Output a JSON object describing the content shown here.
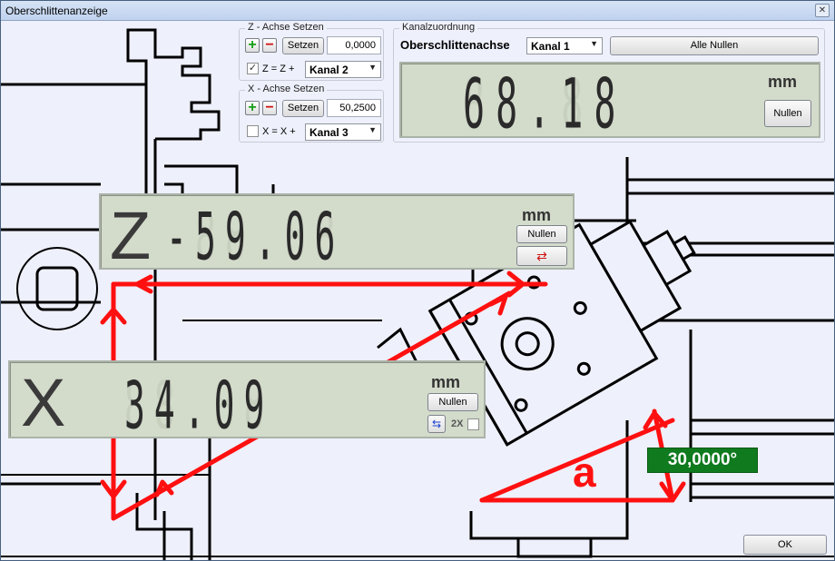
{
  "window": {
    "title": "Oberschlittenanzeige",
    "close_glyph": "✕"
  },
  "z_group": {
    "title": "Z - Achse Setzen",
    "setzen_label": "Setzen",
    "value": "0,0000",
    "checkbox_checked": true,
    "formula": "Z = Z  +",
    "channel": "Kanal 2"
  },
  "x_group": {
    "title": "X - Achse Setzen",
    "setzen_label": "Setzen",
    "value": "50,2500",
    "checkbox_checked": false,
    "formula": "X = X  +",
    "channel": "Kanal 3"
  },
  "kanal": {
    "title": "Kanalzuordnung",
    "axis_label": "Oberschlittenachse",
    "channel": "Kanal 1",
    "zero_all_label": "Alle Nullen"
  },
  "top_display": {
    "value": "68.18",
    "unit": "mm",
    "zero_label": "Nullen"
  },
  "z_display": {
    "axis": "Z",
    "sign": "-",
    "value": "59.06",
    "unit": "mm",
    "zero_label": "Nullen",
    "swap_icon": "direction-swap-icon"
  },
  "x_display": {
    "axis": "X",
    "value": "34.09",
    "unit": "mm",
    "zero_label": "Nullen",
    "diameter_label": "2X",
    "diameter_checked": false
  },
  "angle": {
    "value": "30,0000°",
    "a_label": "a"
  },
  "ok_label": "OK",
  "colors": {
    "lcd_bg": "#d3dbcb",
    "accent_red": "#ff1010",
    "angle_bg": "#0f7a1e"
  }
}
